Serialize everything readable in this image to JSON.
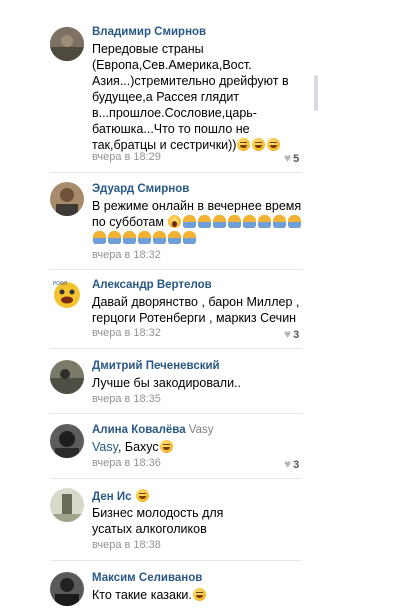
{
  "comments": [
    {
      "author": "Владимир Смирнов",
      "text": "Передовые страны (Европа,Сев.Америка,Вост. Азия...)стремительно дрейфуют в будущее,а Рассея глядит в...прошлое.Сословие,царь-батюшка...Что то пошло не так,братцы и сестрички))",
      "emoji": [
        "laugh",
        "laugh",
        "laugh"
      ],
      "time": "вчера в 18:29",
      "likes": "5",
      "avatar_color": "#6b5f52"
    },
    {
      "author": "Эдуард Смирнов",
      "text": "В режиме онлайн в вечернее время по субботам",
      "emoji": [
        "scream",
        "person",
        "person",
        "person",
        "person",
        "person",
        "person",
        "person",
        "person",
        "person",
        "person",
        "person",
        "person",
        "person",
        "person",
        "person"
      ],
      "time": "вчера в 18:32",
      "likes": "",
      "avatar_color": "#8b6a4a"
    },
    {
      "author": "Александр Вертелов",
      "text": "Давай дворянство , барон Миллер , герцоги Ротенберги , маркиз Сечин",
      "emoji": [],
      "time": "вчера в 18:32",
      "likes": "3",
      "avatar_color": "#f4c430"
    },
    {
      "author": "Дмитрий Печеневский",
      "text": "Лучше бы закодировали..",
      "emoji": [],
      "time": "вчера в 18:35",
      "likes": "",
      "avatar_color": "#5a5a50"
    },
    {
      "author": "Алина Ковалёва",
      "reply_to": "Vasy",
      "mention": "Vasy",
      "text": ", Бахус",
      "emoji": [
        "laugh"
      ],
      "time": "вчера в 18:36",
      "likes": "3",
      "avatar_color": "#3a3a3a"
    },
    {
      "author": "Ден Ис",
      "author_emoji": "laugh",
      "text": "Бизнес молодость для усатых алкоголиков",
      "emoji": [],
      "time": "вчера в 18:38",
      "likes": "",
      "avatar_color": "#c9c9b8"
    },
    {
      "author": "Максим Селиванов",
      "text": "Кто такие казаки.",
      "emoji": [
        "laugh"
      ],
      "time": "",
      "likes": "",
      "avatar_color": "#2a2a2a"
    }
  ]
}
